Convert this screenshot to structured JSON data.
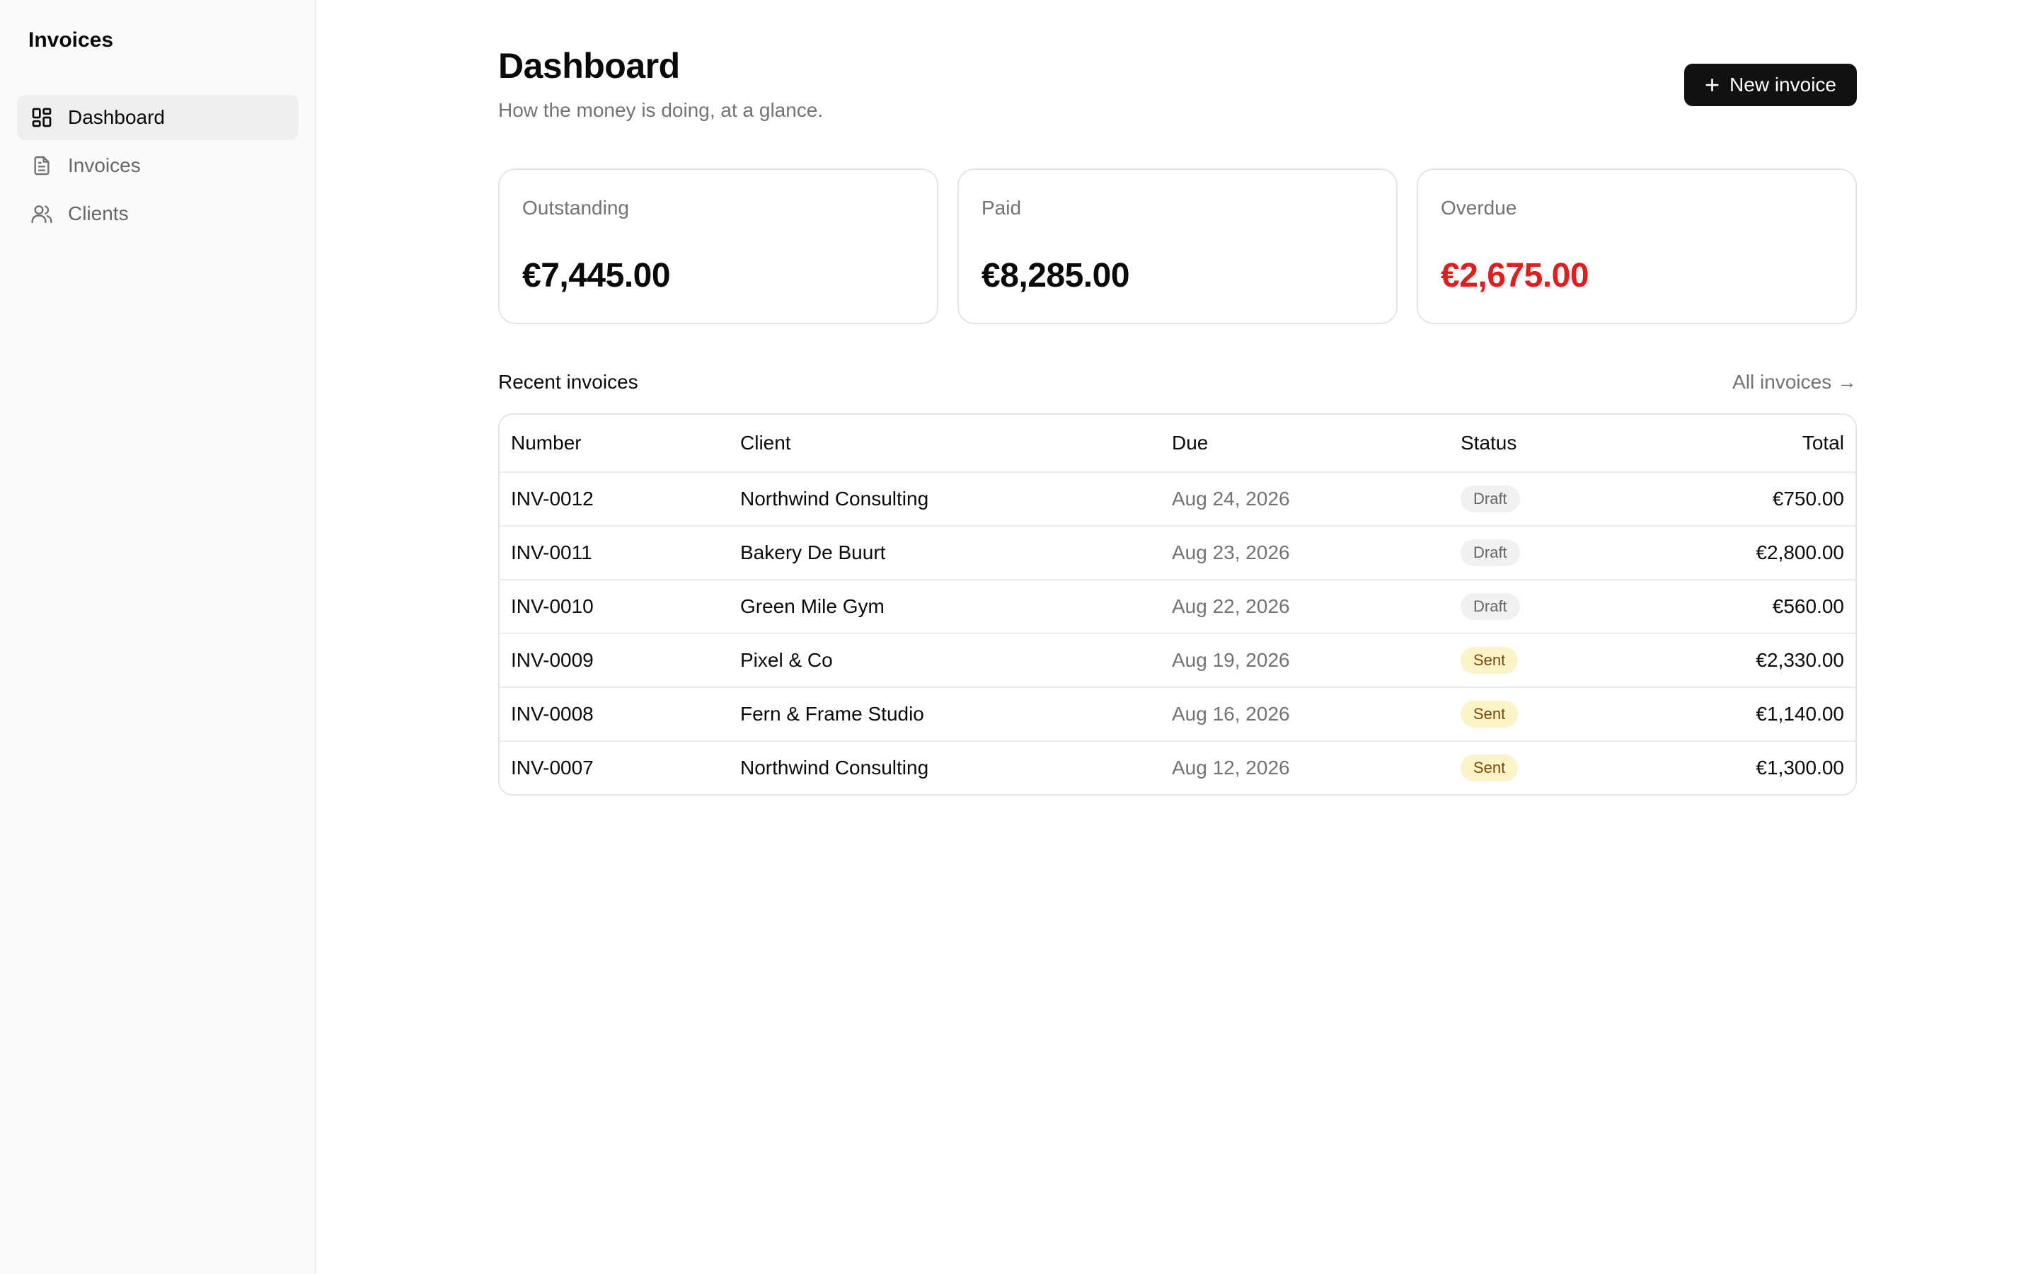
{
  "sidebar": {
    "title": "Invoices",
    "items": [
      {
        "label": "Dashboard",
        "icon": "dashboard-icon",
        "active": true
      },
      {
        "label": "Invoices",
        "icon": "document-icon",
        "active": false
      },
      {
        "label": "Clients",
        "icon": "users-icon",
        "active": false
      }
    ]
  },
  "header": {
    "title": "Dashboard",
    "subtitle": "How the money is doing, at a glance.",
    "new_button": "New invoice"
  },
  "stats": [
    {
      "label": "Outstanding",
      "value": "€7,445.00"
    },
    {
      "label": "Paid",
      "value": "€8,285.00"
    },
    {
      "label": "Overdue",
      "value": "€2,675.00"
    }
  ],
  "recent": {
    "title": "Recent invoices",
    "all_link": "All invoices",
    "columns": [
      "Number",
      "Client",
      "Due",
      "Status",
      "Total"
    ],
    "rows": [
      {
        "number": "INV-0012",
        "client": "Northwind Consulting",
        "due": "Aug 24, 2026",
        "status": "Draft",
        "total": "€750.00"
      },
      {
        "number": "INV-0011",
        "client": "Bakery De Buurt",
        "due": "Aug 23, 2026",
        "status": "Draft",
        "total": "€2,800.00"
      },
      {
        "number": "INV-0010",
        "client": "Green Mile Gym",
        "due": "Aug 22, 2026",
        "status": "Draft",
        "total": "€560.00"
      },
      {
        "number": "INV-0009",
        "client": "Pixel & Co",
        "due": "Aug 19, 2026",
        "status": "Sent",
        "total": "€2,330.00"
      },
      {
        "number": "INV-0008",
        "client": "Fern & Frame Studio",
        "due": "Aug 16, 2026",
        "status": "Sent",
        "total": "€1,140.00"
      },
      {
        "number": "INV-0007",
        "client": "Northwind Consulting",
        "due": "Aug 12, 2026",
        "status": "Sent",
        "total": "€1,300.00"
      }
    ]
  },
  "colors": {
    "accent": "#111111",
    "overdue": "#e11d1d",
    "draft_badge": "#f1f1f1",
    "sent_badge": "#fdf3c8"
  }
}
